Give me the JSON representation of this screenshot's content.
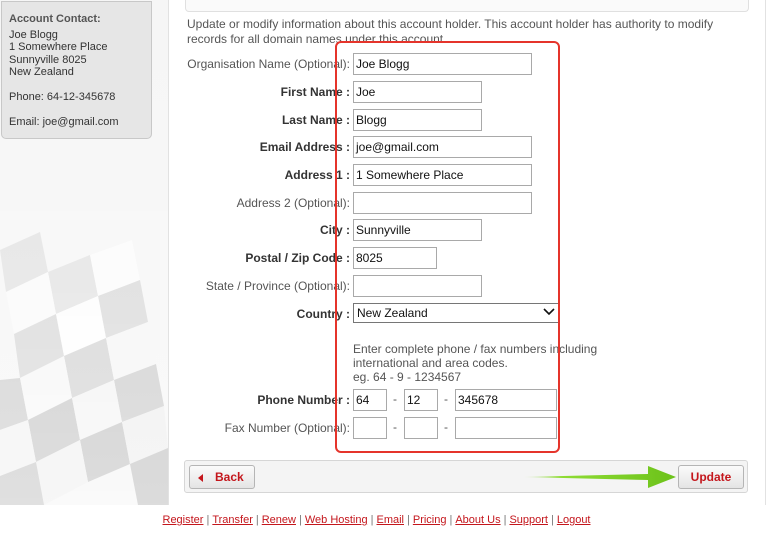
{
  "sidebar": {
    "heading": "Account Contact:",
    "name": "Joe Blogg",
    "address1": "1 Somewhere Place",
    "city_line": "Sunnyville 8025",
    "country": "New Zealand",
    "phone": "Phone: 64-12-345678",
    "email": "Email: joe@gmail.com"
  },
  "intro": "Update or modify information about this account holder. This account holder has authority to modify records for all domain names under this account.",
  "form": {
    "org_label": "Organisation Name (Optional):",
    "org_value": "Joe Blogg",
    "first_label": "First Name :",
    "first_value": "Joe",
    "last_label": "Last Name :",
    "last_value": "Blogg",
    "email_label": "Email Address :",
    "email_value": "joe@gmail.com",
    "addr1_label": "Address 1 :",
    "addr1_value": "1 Somewhere Place",
    "addr2_label": "Address 2 (Optional):",
    "addr2_value": "",
    "city_label": "City :",
    "city_value": "Sunnyville",
    "postal_label": "Postal / Zip Code :",
    "postal_value": "8025",
    "state_label": "State / Province (Optional):",
    "state_value": "",
    "country_label": "Country :",
    "country_value": "New Zealand",
    "phone_note": "Enter complete phone / fax numbers including international and area codes.",
    "phone_example": "eg. 64 - 9 - 1234567",
    "phone_label": "Phone Number :",
    "phone_country": "64",
    "phone_area": "12",
    "phone_number": "345678",
    "fax_label": "Fax Number (Optional):",
    "fax_country": "",
    "fax_area": "",
    "fax_number": "",
    "dash": "-"
  },
  "actions": {
    "back": "Back",
    "update": "Update"
  },
  "footer": {
    "links": [
      "Register",
      "Transfer",
      "Renew",
      "Web Hosting",
      "Email",
      "Pricing",
      "About Us",
      "Support",
      "Logout"
    ]
  },
  "colors": {
    "accent": "#c4161c",
    "highlight": "#e5342b",
    "arrow": "#7ed321"
  }
}
